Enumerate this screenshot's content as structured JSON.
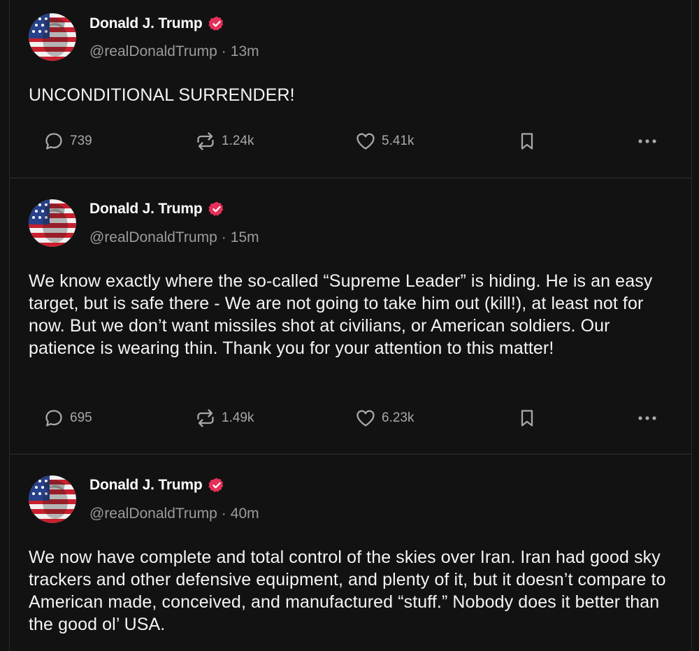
{
  "posts": [
    {
      "author": "Donald J. Trump",
      "handle": "@realDonaldTrump",
      "separator": "·",
      "time": "13m",
      "text": "UNCONDITIONAL SURRENDER!",
      "replies": "739",
      "reposts": "1.24k",
      "likes": "5.41k"
    },
    {
      "author": "Donald J. Trump",
      "handle": "@realDonaldTrump",
      "separator": "·",
      "time": "15m",
      "text": "We know exactly where the so-called “Supreme Leader” is hiding. He is an easy target, but is safe there - We are not going to take him out (kill!), at least not for now. But we don’t want missiles shot at civilians, or American soldiers. Our patience is wearing thin. Thank you for your attention to this matter!",
      "replies": "695",
      "reposts": "1.49k",
      "likes": "6.23k"
    },
    {
      "author": "Donald J. Trump",
      "handle": "@realDonaldTrump",
      "separator": "·",
      "time": "40m",
      "text": "We now have complete and total control of the skies over Iran. Iran had good sky trackers and other defensive equipment, and plenty of it, but it doesn’t compare to American made, conceived, and manufactured “stuff.” Nobody does it better than the good ol’ USA."
    }
  ],
  "icons": {
    "reply": "reply-icon",
    "repost": "repost-icon",
    "like": "heart-icon",
    "bookmark": "bookmark-icon",
    "more": "more-icon",
    "verified": "verified-badge-icon"
  },
  "colors": {
    "background": "#121212",
    "verified_badge": "#e5305a",
    "muted_text": "#9b9b9b",
    "action_text": "#a8a8a8"
  }
}
